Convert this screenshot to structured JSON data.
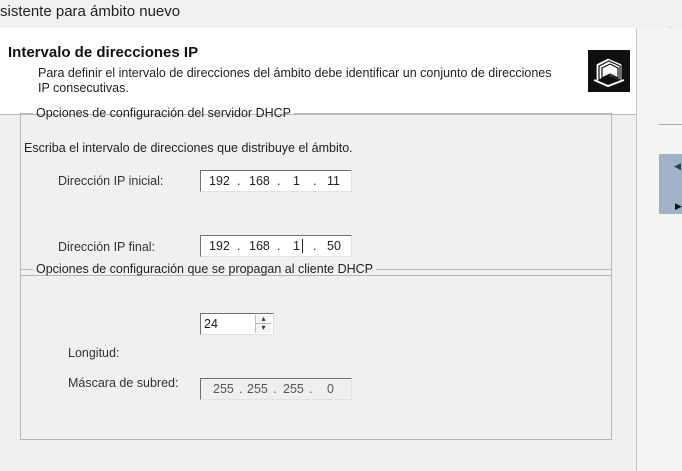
{
  "window": {
    "title": "sistente para ámbito nuevo"
  },
  "header": {
    "title": "Intervalo de direcciones IP",
    "description": "Para definir el intervalo de direcciones del ámbito debe identificar un conjunto de direcciones IP consecutivas.",
    "icon": "folders-icon"
  },
  "server_group": {
    "legend": "Opciones de configuración del servidor DHCP",
    "instruction": "Escriba el intervalo de direcciones que distribuye el ámbito.",
    "start_ip": {
      "label": "Dirección IP inicial:",
      "octets": [
        "192",
        "168",
        "1",
        "11"
      ]
    },
    "end_ip": {
      "label": "Dirección IP final:",
      "octets": [
        "192",
        "168",
        "1",
        "50"
      ]
    },
    "separator": "."
  },
  "client_group": {
    "legend": "Opciones de configuración que se propagan al cliente DHCP",
    "length": {
      "label": "Longitud:",
      "value": "24"
    },
    "subnet_mask": {
      "label": "Máscara de subred:",
      "octets": [
        "255",
        "255",
        "255",
        "0"
      ]
    }
  },
  "colors": {
    "header_bg": "#ffffff",
    "dialog_bg": "#f0f0f0",
    "accent_strip": "#9fb2c7"
  }
}
